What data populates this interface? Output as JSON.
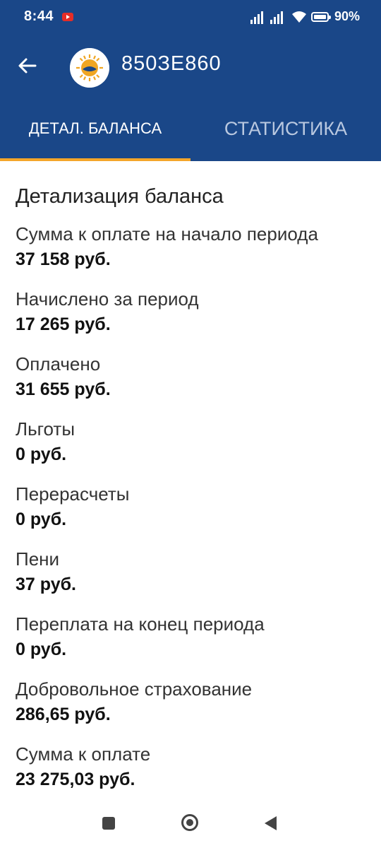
{
  "status_bar": {
    "time": "8:44",
    "battery": "90%"
  },
  "app_bar": {
    "account_number": "850ЗЕ860",
    "tabs": [
      {
        "label": "ДЕТАЛ. БАЛАНСА",
        "active": true
      },
      {
        "label": "СТАТИСТИКА",
        "active": false
      }
    ],
    "accent_color": "#f4a52a",
    "bar_color": "#1a4788"
  },
  "balance": {
    "title": "Детализация баланса",
    "rows": [
      {
        "label": "Сумма к оплате на начало периода",
        "value": "37 158 руб."
      },
      {
        "label": "Начислено за период",
        "value": "17 265 руб."
      },
      {
        "label": "Оплачено",
        "value": "31 655 руб."
      },
      {
        "label": "Льготы",
        "value": "0 руб."
      },
      {
        "label": "Перерасчеты",
        "value": "0 руб."
      },
      {
        "label": "Пени",
        "value": "37 руб."
      },
      {
        "label": "Переплата на конец периода",
        "value": "0 руб."
      },
      {
        "label": "Добровольное страхование",
        "value": "286,65 руб."
      },
      {
        "label": "Сумма к оплате",
        "value": "23 275,03 руб."
      }
    ]
  },
  "icons": {
    "back": "arrow-left-icon",
    "logo": "company-logo",
    "nav": [
      "recents-square-icon",
      "home-circle-icon",
      "back-triangle-icon"
    ]
  }
}
